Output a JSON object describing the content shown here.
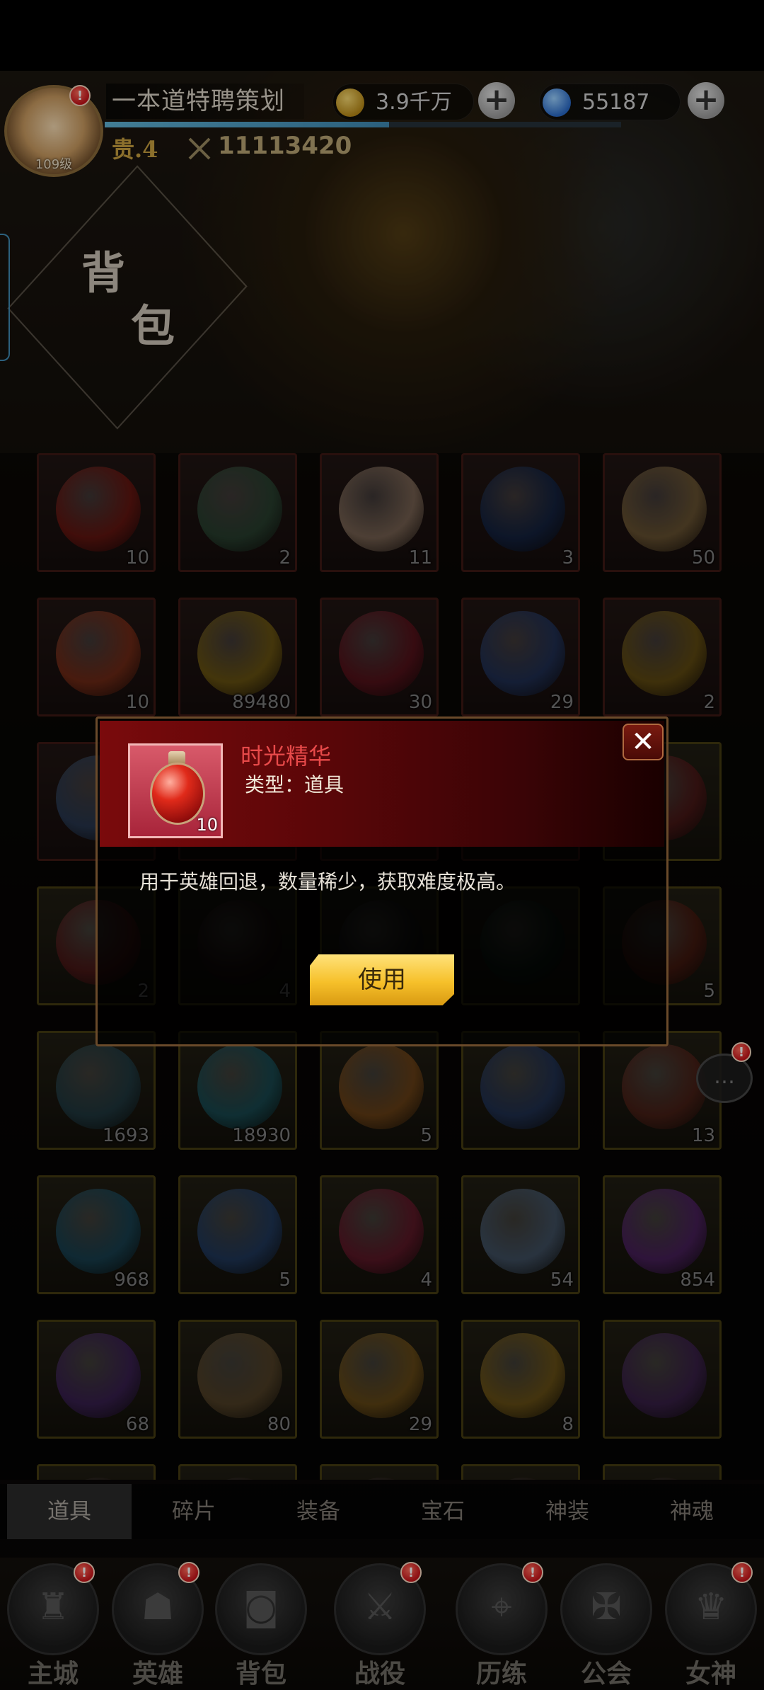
{
  "header": {
    "player_name": "一本道特聘策划",
    "level": "109级",
    "vip": "贵.4",
    "power": "11113420",
    "exp_fraction": 0.55,
    "gold": "3.9千万",
    "gems": "55187",
    "alert_badge": "!"
  },
  "page": {
    "title_char1": "背",
    "title_char2": "包"
  },
  "grid": {
    "items": [
      {
        "qty": "10",
        "color": "#c0281e",
        "frame": "red"
      },
      {
        "qty": "2",
        "color": "#4a7a5a",
        "frame": "red"
      },
      {
        "qty": "11",
        "color": "#e8c0a0",
        "frame": "red"
      },
      {
        "qty": "3",
        "color": "#22407a",
        "frame": "red"
      },
      {
        "qty": "50",
        "color": "#c8a060",
        "frame": "red"
      },
      {
        "qty": "10",
        "color": "#d8502a",
        "frame": "red"
      },
      {
        "qty": "89480",
        "color": "#c8a020",
        "frame": "red"
      },
      {
        "qty": "30",
        "color": "#a02030",
        "frame": "red"
      },
      {
        "qty": "29",
        "color": "#3a5aa0",
        "frame": "red"
      },
      {
        "qty": "2",
        "color": "#b89020",
        "frame": "red"
      },
      {
        "qty": "",
        "color": "#4a6a9a",
        "frame": "red"
      },
      {
        "qty": "",
        "color": "#6a3020",
        "frame": "red"
      },
      {
        "qty": "",
        "color": "#5a2a2a",
        "frame": "red"
      },
      {
        "qty": "",
        "color": "#5a2020",
        "frame": "red"
      },
      {
        "qty": "",
        "color": "#8a2a2a",
        "frame": "gold"
      },
      {
        "qty": "2",
        "color": "#8a2a2a",
        "frame": "gold"
      },
      {
        "qty": "4",
        "color": "#3a2020",
        "frame": "gold"
      },
      {
        "qty": "",
        "color": "#2a2a2a",
        "frame": "gold"
      },
      {
        "qty": "",
        "color": "#1a3a2a",
        "frame": "gold"
      },
      {
        "qty": "5",
        "color": "#7a2a1a",
        "frame": "gold"
      },
      {
        "qty": "1693",
        "color": "#3a6a7a",
        "frame": "gold"
      },
      {
        "qty": "18930",
        "color": "#2a8a9a",
        "frame": "gold"
      },
      {
        "qty": "5",
        "color": "#c87a2a",
        "frame": "gold"
      },
      {
        "qty": "",
        "color": "#3a5a9a",
        "frame": "gold"
      },
      {
        "qty": "13",
        "color": "#8a3a2a",
        "frame": "gold"
      },
      {
        "qty": "968",
        "color": "#2a7a9a",
        "frame": "gold"
      },
      {
        "qty": "5",
        "color": "#3a6ab0",
        "frame": "gold"
      },
      {
        "qty": "4",
        "color": "#b02a4a",
        "frame": "gold"
      },
      {
        "qty": "54",
        "color": "#7a9ac0",
        "frame": "gold"
      },
      {
        "qty": "854",
        "color": "#8a3ab0",
        "frame": "gold"
      },
      {
        "qty": "68",
        "color": "#6a3a9a",
        "frame": "gold"
      },
      {
        "qty": "80",
        "color": "#9a7a4a",
        "frame": "gold"
      },
      {
        "qty": "29",
        "color": "#c08a2a",
        "frame": "gold"
      },
      {
        "qty": "8",
        "color": "#c89a2a",
        "frame": "gold"
      },
      {
        "qty": "",
        "color": "#6a3a8a",
        "frame": "gold"
      },
      {
        "qty": "",
        "color": "#3a2a22",
        "frame": "gold"
      },
      {
        "qty": "",
        "color": "#3a2a22",
        "frame": "gold"
      },
      {
        "qty": "",
        "color": "#3a2a22",
        "frame": "gold"
      },
      {
        "qty": "",
        "color": "#3a2a22",
        "frame": "gold"
      },
      {
        "qty": "",
        "color": "#3a2a22",
        "frame": "gold"
      }
    ]
  },
  "tabs": [
    {
      "label": "道具",
      "active": true
    },
    {
      "label": "碎片",
      "active": false
    },
    {
      "label": "装备",
      "active": false
    },
    {
      "label": "宝石",
      "active": false
    },
    {
      "label": "神装",
      "active": false
    },
    {
      "label": "神魂",
      "active": false
    }
  ],
  "nav": [
    {
      "label": "主城",
      "icon": "castle-icon",
      "glyph": "♜",
      "badge": "!"
    },
    {
      "label": "英雄",
      "icon": "hero-icon",
      "glyph": "☗",
      "badge": "!"
    },
    {
      "label": "背包",
      "icon": "backpack-icon",
      "glyph": "◙",
      "badge": ""
    },
    {
      "label": "战役",
      "icon": "crossed-swords-icon",
      "glyph": "⚔",
      "badge": "!"
    },
    {
      "label": "历练",
      "icon": "map-icon",
      "glyph": "⌖",
      "badge": "!"
    },
    {
      "label": "公会",
      "icon": "shield-icon",
      "glyph": "✠",
      "badge": ""
    },
    {
      "label": "女神",
      "icon": "goddess-icon",
      "glyph": "♛",
      "badge": "!"
    }
  ],
  "chat": {
    "icon": "chat-bubble-icon",
    "glyph": "…",
    "badge": "!"
  },
  "popup": {
    "item_name": "时光精华",
    "item_type": "类型：道具",
    "item_qty": "10",
    "description": "用于英雄回退，数量稀少，获取难度极高。",
    "use_label": "使用",
    "close_glyph": "✕"
  },
  "colors": {
    "item_name": "#e84a4a",
    "use_button": "#f6c02a",
    "popup_header": "#7a0a0c",
    "exp_bar": "#5fb4d6"
  }
}
